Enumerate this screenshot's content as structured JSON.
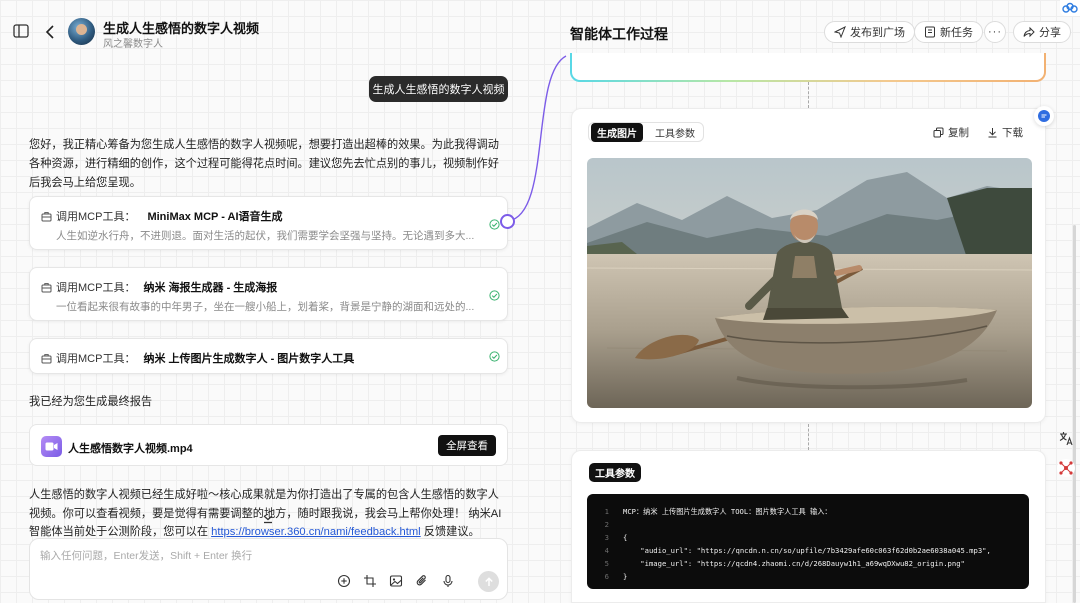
{
  "header": {
    "title": "生成人生感悟的数字人视频",
    "subtitle": "风之馨数字人",
    "panel_title": "智能体工作过程",
    "publish_label": "发布到广场",
    "new_task_label": "新任务",
    "more_label": "···",
    "share_label": "分享"
  },
  "chat": {
    "user_message": "生成人生感悟的数字人视频",
    "reply_intro": "您好，我正精心筹备为您生成人生感悟的数字人视频呢，想要打造出超棒的效果。为此我得调动各种资源，进行精细的创作，这个过程可能得花点时间。建议您先去忙点别的事儿，视频制作好后我会马上给您呈现。",
    "tool_calls": [
      {
        "prefix": "调用MCP工具：",
        "name": "MiniMax MCP - AI语音生成",
        "detail": "人生如逆水行舟，不进则退。面对生活的起伏，我们需要学会坚强与坚持。无论遇到多大..."
      },
      {
        "prefix": "调用MCP工具：",
        "name": "纳米 海报生成器 - 生成海报",
        "detail": "一位看起来很有故事的中年男子，坐在一艘小船上，划着桨，背景是宁静的湖面和远处的..."
      },
      {
        "prefix": "调用MCP工具：",
        "name": "纳米 上传图片生成数字人 - 图片数字人工具",
        "detail": ""
      }
    ],
    "report_label": "我已经为您生成最终报告",
    "video": {
      "filename": "人生感悟数字人视频.mp4",
      "button_label": "全屏查看"
    },
    "final_text_before_link": "人生感悟的数字人视频已经生成好啦～核心成果就是为你打造出了专属的包含人生感悟的数字人视频。你可以查看视频，要是觉得有需要调整的地方，随时跟我说，我会马上帮你处理！ 纳米AI智能体当前处于公测阶段，您可以在 ",
    "final_link": "https://browser.360.cn/nami/feedback.html",
    "final_text_after_link": " 反馈建议。"
  },
  "input": {
    "placeholder": "输入任何问题，Enter发送，Shift + Enter 换行",
    "value": ""
  },
  "image_card": {
    "tab_active": "生成图片",
    "tab_inactive": "工具参数",
    "copy_label": "复制",
    "download_label": "下载"
  },
  "params_card": {
    "title": "工具参数",
    "code_lines": [
      {
        "n": "1",
        "text": "MCP：纳米 上传图片生成数字人 TOOL：图片数字人工具 输入："
      },
      {
        "n": "2",
        "text": ""
      },
      {
        "n": "3",
        "text": "{"
      },
      {
        "n": "4",
        "text": "    \"audio_url\": \"https://qncdn.n.cn/so/upfile/7b3429afe60c063f62d0b2ae6038a045.mp3\","
      },
      {
        "n": "5",
        "text": "    \"image_url\": \"https://qcdn4.zhaomi.cn/d/268Dauyw1h1_a69wqDXwu82_origin.png\""
      },
      {
        "n": "6",
        "text": "}"
      }
    ]
  },
  "colors": {
    "accent_purple": "#7c5ce8",
    "check_green": "#3cb371",
    "link_blue": "#2458d6",
    "dark_button": "#111111"
  },
  "icons": {
    "sidebar": "sidebar-toggle-icon",
    "back": "chevron-left-icon",
    "publish": "send-icon",
    "new_task": "new-task-icon",
    "share": "share-icon",
    "tool": "toolbox-icon",
    "check": "check-circle-icon",
    "copy": "copy-icon",
    "download": "download-icon"
  }
}
